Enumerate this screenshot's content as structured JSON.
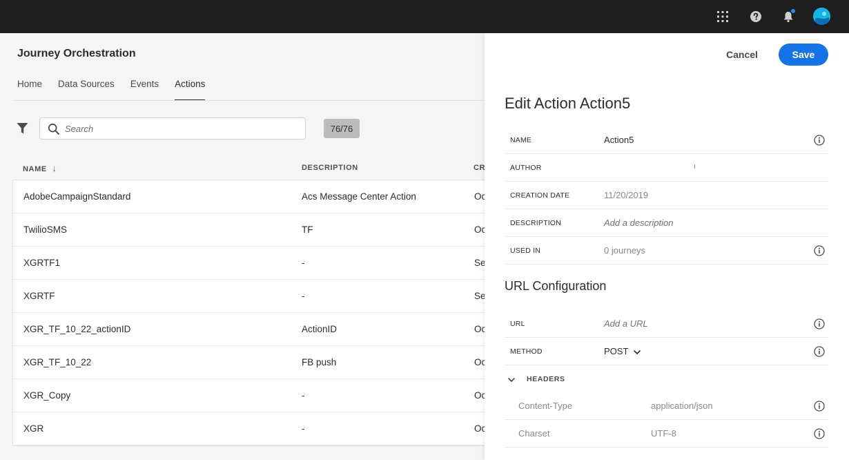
{
  "topbar": {
    "icons": [
      "apps-grid-icon",
      "help-icon",
      "notification-bell-icon",
      "user-avatar"
    ],
    "accent": "#1e8cf0"
  },
  "app": {
    "title": "Journey Orchestration"
  },
  "tabs": [
    {
      "label": "Home",
      "active": false
    },
    {
      "label": "Data Sources",
      "active": false
    },
    {
      "label": "Events",
      "active": false
    },
    {
      "label": "Actions",
      "active": true
    }
  ],
  "toolbar": {
    "search_placeholder": "Search",
    "search_value": "",
    "count": "76/76"
  },
  "table": {
    "columns": [
      "NAME",
      "DESCRIPTION",
      "CR"
    ],
    "rows": [
      {
        "name": "AdobeCampaignStandard",
        "description": "Acs Message Center Action",
        "created": "Oc"
      },
      {
        "name": "TwilioSMS",
        "description": "TF",
        "created": "Oc"
      },
      {
        "name": "XGRTF1",
        "description": "-",
        "created": "Se"
      },
      {
        "name": "XGRTF",
        "description": "-",
        "created": "Se"
      },
      {
        "name": "XGR_TF_10_22_actionID",
        "description": "ActionID",
        "created": "Oc"
      },
      {
        "name": "XGR_TF_10_22",
        "description": "FB push",
        "created": "Oc"
      },
      {
        "name": "XGR_Copy",
        "description": "-",
        "created": "Oc"
      },
      {
        "name": "XGR",
        "description": "-",
        "created": "Oc"
      }
    ]
  },
  "panel": {
    "cancel_label": "Cancel",
    "save_label": "Save",
    "title": "Edit Action Action5",
    "fields": {
      "name": {
        "label": "NAME",
        "value": "Action5"
      },
      "author": {
        "label": "AUTHOR",
        "value": "ı"
      },
      "creation_date": {
        "label": "CREATION DATE",
        "value": "11/20/2019"
      },
      "description": {
        "label": "DESCRIPTION",
        "placeholder": "Add a description"
      },
      "used_in": {
        "label": "USED IN",
        "value": "0 journeys"
      }
    },
    "url_section": {
      "title": "URL Configuration",
      "url": {
        "label": "URL",
        "placeholder": "Add a URL"
      },
      "method": {
        "label": "METHOD",
        "value": "POST"
      },
      "headers": {
        "label": "HEADERS",
        "items": [
          {
            "key": "Content-Type",
            "value": "application/json"
          },
          {
            "key": "Charset",
            "value": "UTF-8"
          }
        ]
      }
    },
    "save_color": "#1473e6"
  }
}
